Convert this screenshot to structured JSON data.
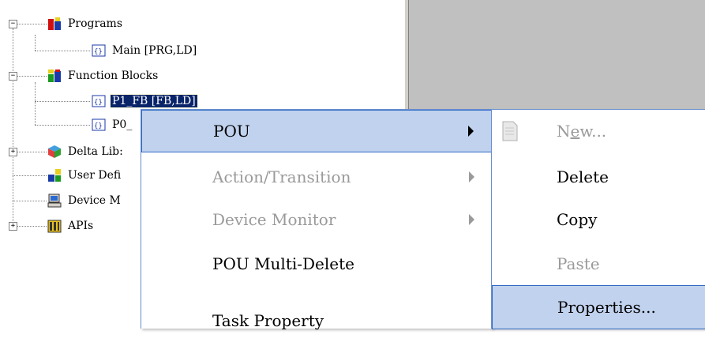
{
  "tree": {
    "items": [
      {
        "label": "Programs"
      },
      {
        "label": "Main [PRG,LD]"
      },
      {
        "label": "Function Blocks"
      },
      {
        "label": "P1_FB [FB,LD]"
      },
      {
        "label": "P0_"
      },
      {
        "label": "Delta Lib:"
      },
      {
        "label": "User Defi"
      },
      {
        "label": "Device M"
      },
      {
        "label": "APIs"
      }
    ]
  },
  "context_menu": {
    "items": [
      {
        "label": "POU"
      },
      {
        "label": "Action/Transition"
      },
      {
        "label": "Device Monitor"
      },
      {
        "label": "POU Multi-Delete"
      },
      {
        "label": "Task Property"
      }
    ]
  },
  "submenu": {
    "new_prefix": "N",
    "new_underlined": "e",
    "new_suffix": "w...",
    "items": [
      {
        "label": "Delete"
      },
      {
        "label": "Copy"
      },
      {
        "label": "Paste"
      },
      {
        "label": "Properties..."
      }
    ]
  },
  "colors": {
    "selection": "#0a246a",
    "menu_hover": "#c1d2ee",
    "menu_border": "#316ac5",
    "disabled_text": "#9a9a9a",
    "right_pane": "#c0c0c0"
  }
}
